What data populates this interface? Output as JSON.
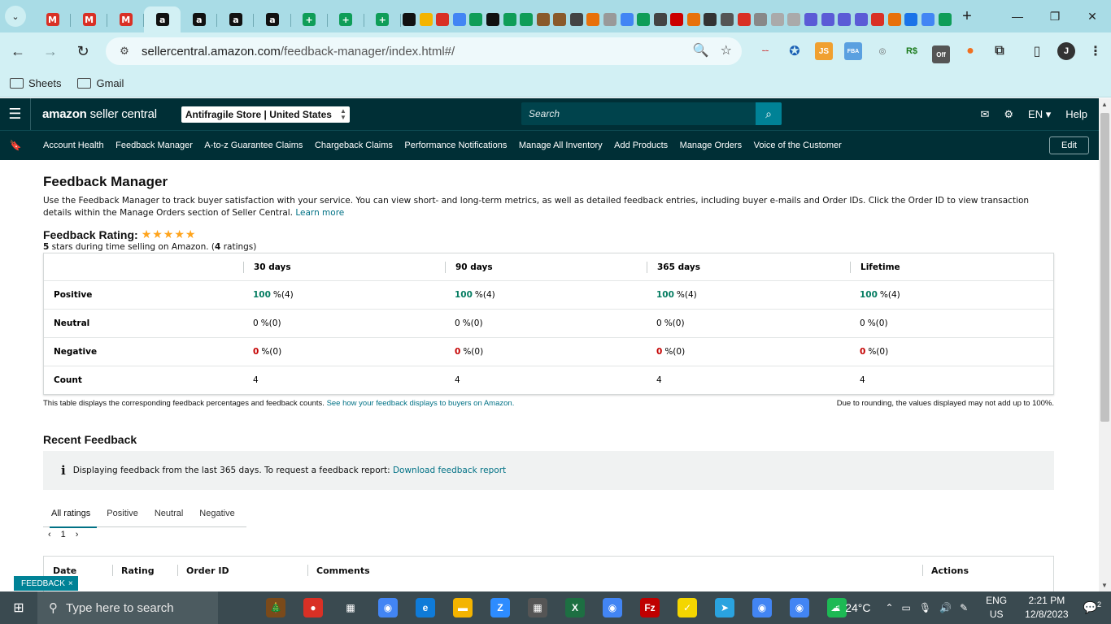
{
  "browser": {
    "url_host": "sellercentral.amazon.com",
    "url_path": "/feedback-manager/index.html#/",
    "bookmarks": [
      "Sheets",
      "Gmail"
    ],
    "profile_initial": "J"
  },
  "header": {
    "logo_bold": "amazon",
    "logo_rest": " seller central",
    "store": "Antifragile Store | United States",
    "search_placeholder": "Search",
    "language": "EN",
    "help": "Help"
  },
  "nav": {
    "items": [
      "Account Health",
      "Feedback Manager",
      "A-to-z Guarantee Claims",
      "Chargeback Claims",
      "Performance Notifications",
      "Manage All Inventory",
      "Add Products",
      "Manage Orders",
      "Voice of the Customer"
    ],
    "edit": "Edit"
  },
  "main": {
    "title": "Feedback Manager",
    "description": "Use the Feedback Manager to track buyer satisfaction with your service. You can view short- and long-term metrics, as well as detailed feedback entries, including buyer e-mails and Order IDs. Click the Order ID to view transaction details within the Manage Orders section of Seller Central.",
    "learn_more": "Learn more",
    "rating_label": "Feedback Rating:",
    "rating_stars": 5,
    "rating_sub_stars": "5",
    "rating_sub_text": " stars during time selling on Amazon. (",
    "rating_count": "4",
    "rating_sub_end": " ratings)"
  },
  "table": {
    "columns": [
      "30 days",
      "90 days",
      "365 days",
      "Lifetime"
    ],
    "rows": [
      {
        "label": "Positive",
        "cells": [
          {
            "pct": "100",
            "rest": " %(4)"
          },
          {
            "pct": "100",
            "rest": " %(4)"
          },
          {
            "pct": "100",
            "rest": " %(4)"
          },
          {
            "pct": "100",
            "rest": " %(4)"
          }
        ]
      },
      {
        "label": "Neutral",
        "cells": [
          {
            "pct": "0",
            "rest": " %(0)"
          },
          {
            "pct": "0",
            "rest": " %(0)"
          },
          {
            "pct": "0",
            "rest": " %(0)"
          },
          {
            "pct": "0",
            "rest": " %(0)"
          }
        ]
      },
      {
        "label": "Negative",
        "cells": [
          {
            "pct": "0",
            "rest": " %(0)"
          },
          {
            "pct": "0",
            "rest": " %(0)"
          },
          {
            "pct": "0",
            "rest": " %(0)"
          },
          {
            "pct": "0",
            "rest": " %(0)"
          }
        ]
      },
      {
        "label": "Count",
        "cells": [
          {
            "pct": "",
            "rest": "4"
          },
          {
            "pct": "",
            "rest": "4"
          },
          {
            "pct": "",
            "rest": "4"
          },
          {
            "pct": "",
            "rest": "4"
          }
        ]
      }
    ],
    "note_left": "This table displays the corresponding feedback percentages and feedback counts.",
    "note_link": "See how your feedback displays to buyers on Amazon.",
    "note_right": "Due to rounding, the values displayed may not add up to 100%."
  },
  "recent": {
    "title": "Recent Feedback",
    "info": "Displaying feedback from the last 365 days. To request a feedback report:",
    "info_link": "Download feedback report",
    "tabs": [
      "All ratings",
      "Positive",
      "Neutral",
      "Negative"
    ],
    "page": "1",
    "columns": [
      "Date",
      "Rating",
      "Order ID",
      "Comments",
      "Actions"
    ]
  },
  "feedback_tag": "FEEDBACK",
  "taskbar": {
    "search_placeholder": "Type here to search",
    "temperature": "24°C",
    "lang1": "ENG",
    "lang2": "US",
    "time": "2:21 PM",
    "date": "12/8/2023",
    "notifications": "2"
  }
}
